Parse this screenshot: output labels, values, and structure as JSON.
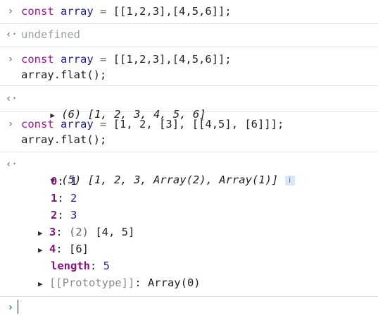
{
  "entries": [
    {
      "input": {
        "kw": "const",
        "name": "array",
        "op": "=",
        "value": "[[1,2,3],[4,5,6]];"
      },
      "output": {
        "text": "undefined"
      }
    },
    {
      "input": {
        "kw": "const",
        "name": "array",
        "op": "=",
        "value": "[[1,2,3],[4,5,6]];",
        "line2": "array.flat();"
      },
      "output": {
        "summary": "(6) [1, 2, 3, 4, 5, 6]"
      }
    },
    {
      "input": {
        "kw": "const",
        "name": "array",
        "op": "=",
        "value": "[1, 2, [3], [[4,5], [6]]];",
        "line2": "array.flat();"
      },
      "output": {
        "summary": "(5) [1, 2, 3, Array(2), Array(1)]",
        "info_badge": "i",
        "items": [
          {
            "key": "0",
            "value": "1"
          },
          {
            "key": "1",
            "value": "2"
          },
          {
            "key": "2",
            "value": "3"
          },
          {
            "key": "3",
            "len": "(2)",
            "value": "[4, 5]"
          },
          {
            "key": "4",
            "value": "[6]"
          }
        ],
        "length_key": "length",
        "length_value": "5",
        "prototype_key": "[[Prototype]]",
        "prototype_value": "Array(0)"
      }
    }
  ],
  "prompt_symbol": "›",
  "input_arrow": "›",
  "output_arrow": "‹·"
}
